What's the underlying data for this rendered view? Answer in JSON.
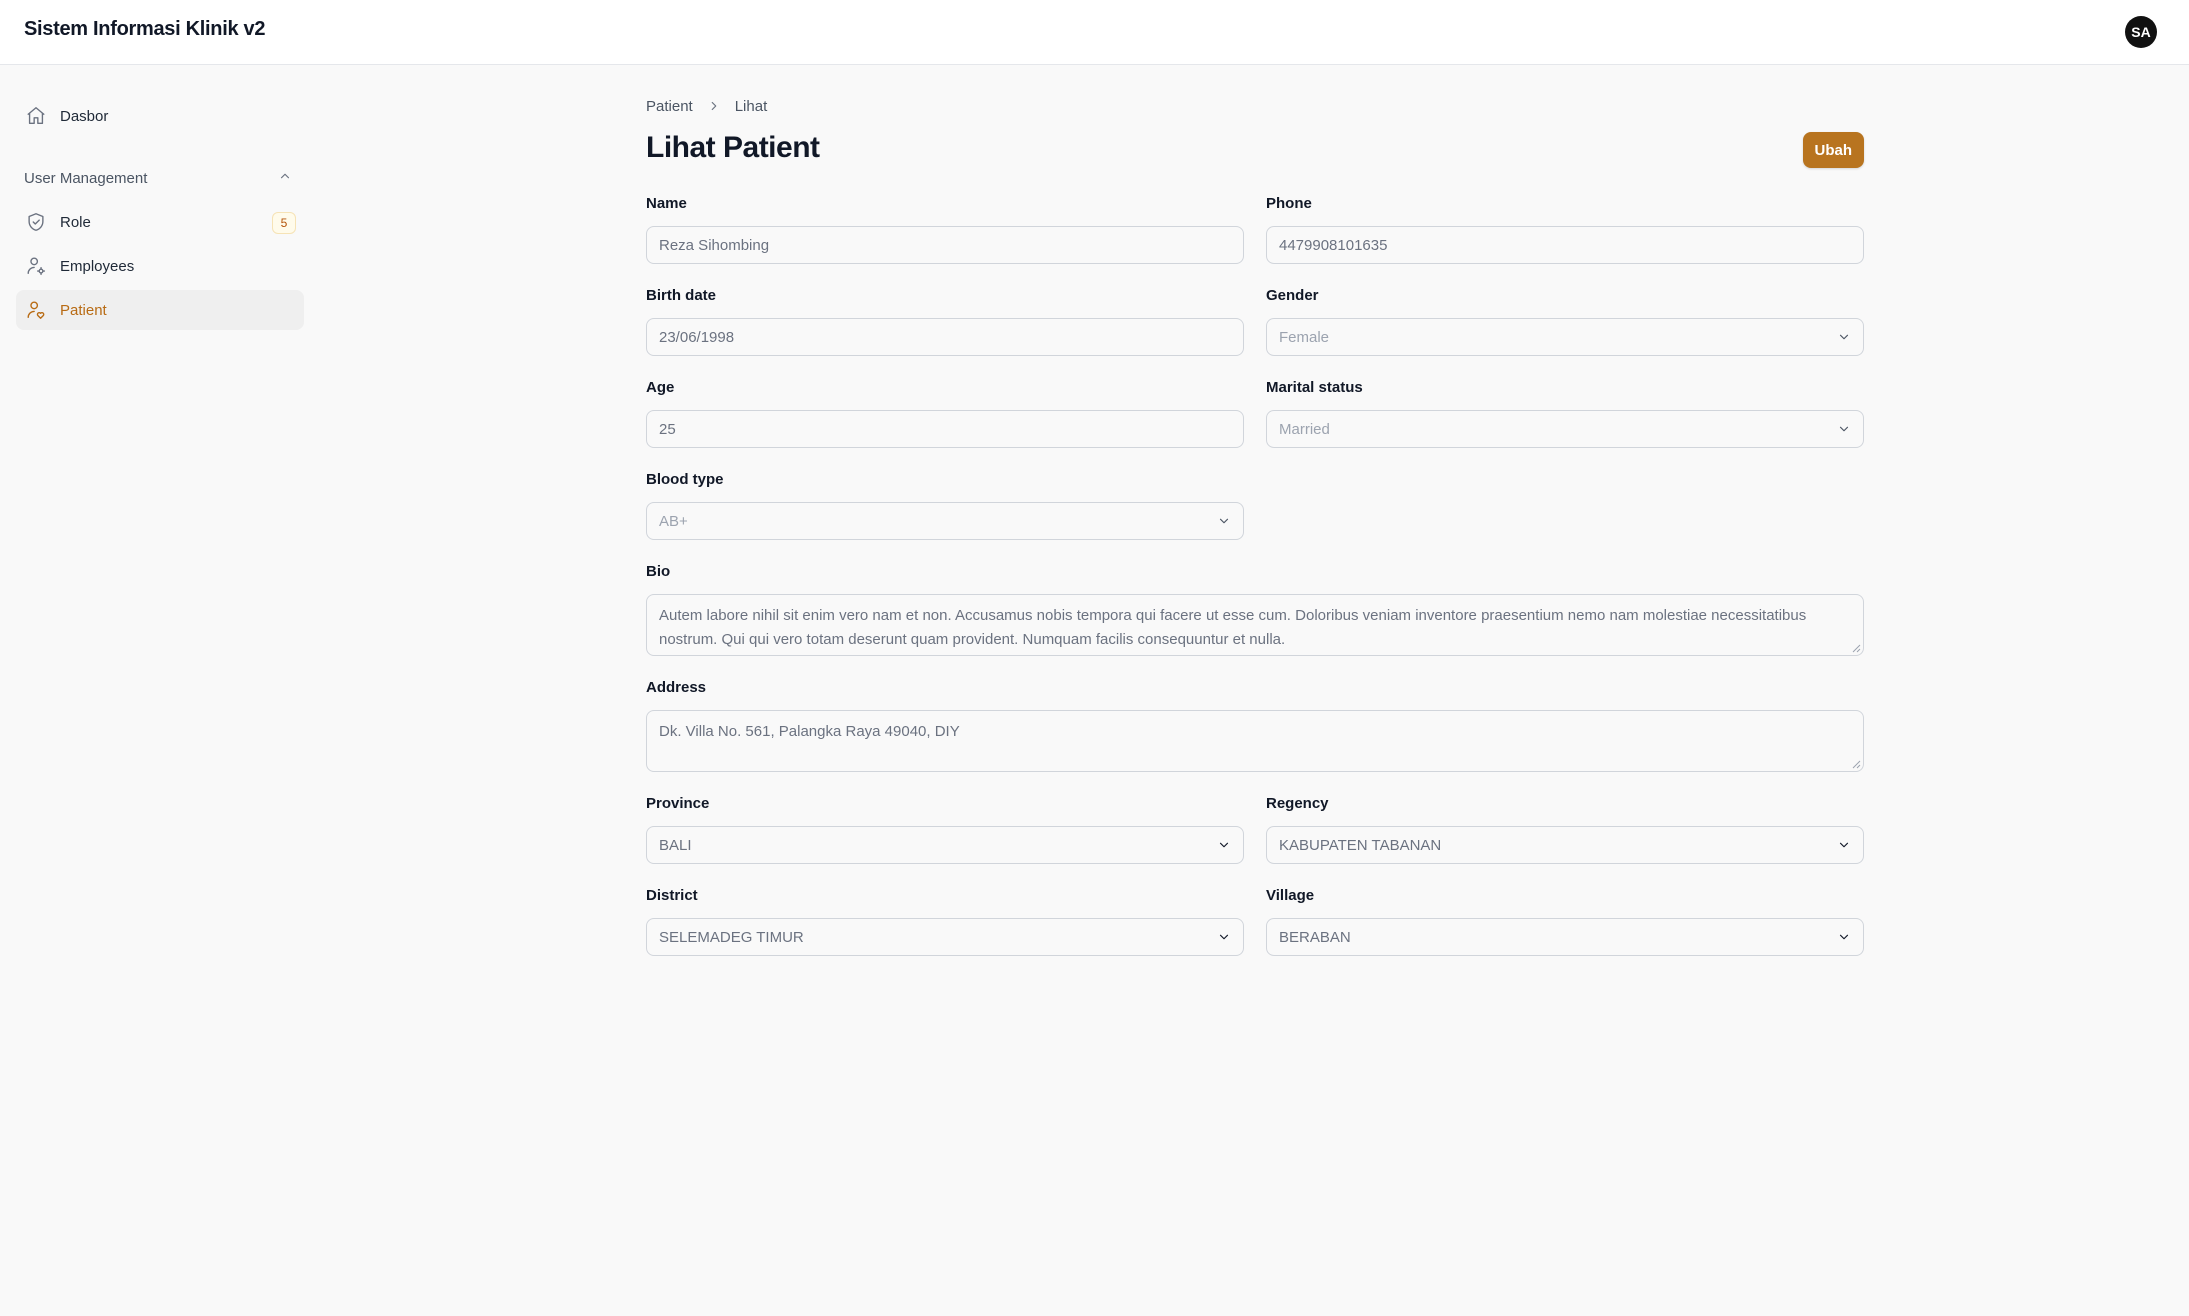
{
  "app": {
    "title": "Sistem Informasi Klinik v2",
    "user_initials": "SA"
  },
  "sidebar": {
    "dashboard": {
      "label": "Dasbor",
      "icon": "home-icon"
    },
    "group": {
      "label": "User Management",
      "icon": "chevron-up-icon"
    },
    "items": [
      {
        "label": "Role",
        "icon": "shield-check-icon",
        "badge": "5"
      },
      {
        "label": "Employees",
        "icon": "user-cog-icon"
      },
      {
        "label": "Patient",
        "icon": "user-heart-icon",
        "active": true
      }
    ]
  },
  "breadcrumb": {
    "parent": "Patient",
    "current": "Lihat"
  },
  "page": {
    "title": "Lihat Patient",
    "edit_label": "Ubah"
  },
  "form": {
    "name": {
      "label": "Name",
      "value": "Reza Sihombing"
    },
    "phone": {
      "label": "Phone",
      "value": "4479908101635"
    },
    "birth_date": {
      "label": "Birth date",
      "value": "23/06/1998"
    },
    "gender": {
      "label": "Gender",
      "value": "Female"
    },
    "age": {
      "label": "Age",
      "value": "25"
    },
    "marital_status": {
      "label": "Marital status",
      "value": "Married"
    },
    "blood_type": {
      "label": "Blood type",
      "value": "AB+"
    },
    "bio": {
      "label": "Bio",
      "value": "Autem labore nihil sit enim vero nam et non. Accusamus nobis tempora qui facere ut esse cum. Doloribus veniam inventore praesentium nemo nam molestiae necessitatibus nostrum. Qui qui vero totam deserunt quam provident. Numquam facilis consequuntur et nulla."
    },
    "address": {
      "label": "Address",
      "value": "Dk. Villa No. 561, Palangka Raya 49040, DIY"
    },
    "province": {
      "label": "Province",
      "value": "BALI"
    },
    "regency": {
      "label": "Regency",
      "value": "KABUPATEN TABANAN"
    },
    "district": {
      "label": "District",
      "value": "SELEMADEG TIMUR"
    },
    "village": {
      "label": "Village",
      "value": "BERABAN"
    }
  },
  "colors": {
    "accent": "#b8741f",
    "active_text": "#b86b14",
    "badge_bg": "#fffbeb",
    "badge_text": "#b45309"
  }
}
